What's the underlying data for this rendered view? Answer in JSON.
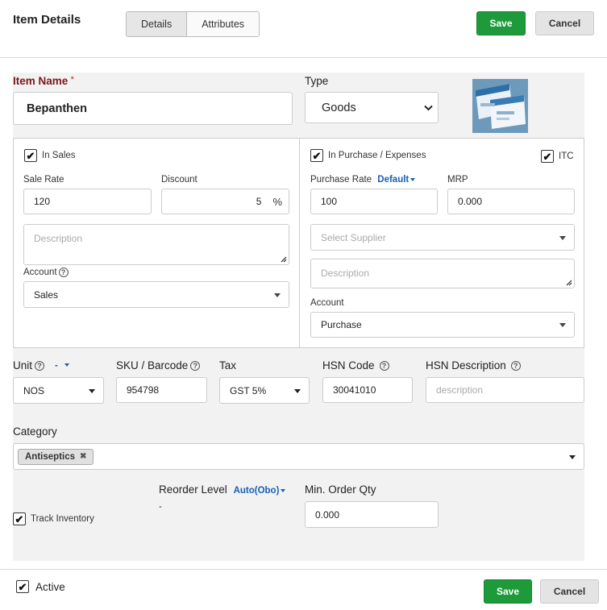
{
  "header": {
    "title": "Item Details",
    "tabs": [
      {
        "label": "Details"
      },
      {
        "label": "Attributes"
      }
    ],
    "save_label": "Save",
    "cancel_label": "Cancel"
  },
  "item": {
    "name_label": "Item Name",
    "name_required_mark": "*",
    "name_value": "Bepanthen",
    "type_label": "Type",
    "type_value": "Goods"
  },
  "sales": {
    "checkbox_label": "In Sales",
    "checked": true,
    "sale_rate_label": "Sale Rate",
    "sale_rate_value": "120",
    "discount_label": "Discount",
    "discount_value": "5",
    "discount_unit": "%",
    "description_placeholder": "Description",
    "account_label": "Account",
    "account_value": "Sales"
  },
  "purchase": {
    "checkbox_label": "In Purchase / Expenses",
    "checked": true,
    "itc_label": "ITC",
    "itc_checked": true,
    "purchase_rate_label": "Purchase Rate",
    "purchase_rate_mode": "Default",
    "purchase_rate_value": "100",
    "mrp_label": "MRP",
    "mrp_value": "0.000",
    "supplier_placeholder": "Select Supplier",
    "description_placeholder": "Description",
    "account_label": "Account",
    "account_value": "Purchase"
  },
  "details": {
    "unit_label": "Unit",
    "unit_link": "-",
    "unit_value": "NOS",
    "sku_label": "SKU / Barcode",
    "sku_value": "954798",
    "tax_label": "Tax",
    "tax_value": "GST 5%",
    "hsn_code_label": "HSN Code",
    "hsn_code_value": "30041010",
    "hsn_desc_label": "HSN Description",
    "hsn_desc_placeholder": "description"
  },
  "category": {
    "label": "Category",
    "tags": [
      {
        "label": "Antiseptics"
      }
    ]
  },
  "inventory": {
    "track_label": "Track Inventory",
    "track_checked": true,
    "reorder_label": "Reorder Level",
    "reorder_mode": "Auto(Obo)",
    "reorder_value": "-",
    "min_order_label": "Min. Order Qty",
    "min_order_value": "0.000"
  },
  "footer": {
    "active_label": "Active",
    "active_checked": true,
    "save_label": "Save",
    "cancel_label": "Cancel"
  },
  "icons": {
    "check": "✔",
    "help": "?",
    "remove": "✖"
  },
  "colors": {
    "save_green": "#1e9a3a",
    "required_label": "#7a1717",
    "link_blue": "#1a5fb4"
  }
}
